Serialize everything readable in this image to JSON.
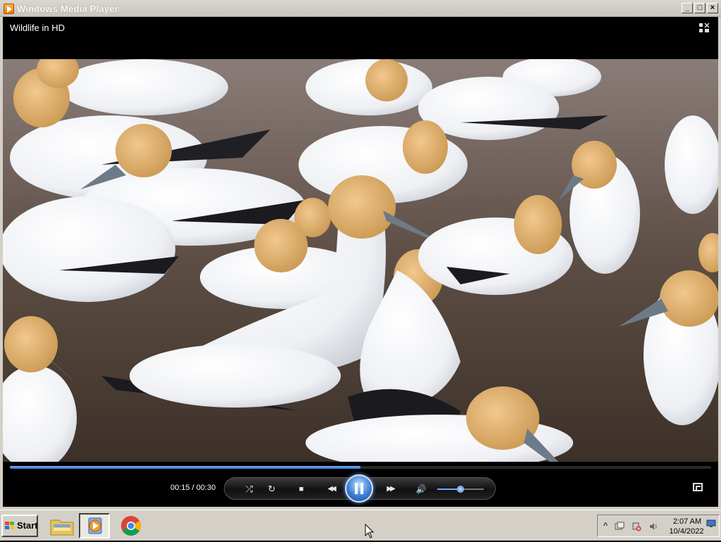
{
  "window": {
    "title": "Windows Media Player",
    "controls": {
      "minimize": "_",
      "maximize": "□",
      "close": "×"
    }
  },
  "player": {
    "now_playing": "Wildlife in HD",
    "layout_icon": "switch-to-library-icon",
    "time_display": "00:15 / 00:30",
    "progress_fraction": 0.5,
    "volume_fraction": 0.5,
    "accent_color": "#3b7fd4",
    "buttons": {
      "shuffle": "⤮",
      "repeat": "↻",
      "stop": "■",
      "previous": "◀◀",
      "play_pause_state": "pause",
      "next": "▶▶",
      "mute": "🔊"
    }
  },
  "taskbar": {
    "start_label": "Start",
    "apps": [
      {
        "name": "File Explorer",
        "icon": "folder-icon",
        "active": false
      },
      {
        "name": "Windows Media Player",
        "icon": "media-player-icon",
        "active": true
      },
      {
        "name": "Google Chrome",
        "icon": "chrome-icon",
        "active": false
      }
    ],
    "tray": {
      "overflow": "^",
      "clock_time": "2:07 AM",
      "clock_date": "10/4/2022"
    }
  }
}
